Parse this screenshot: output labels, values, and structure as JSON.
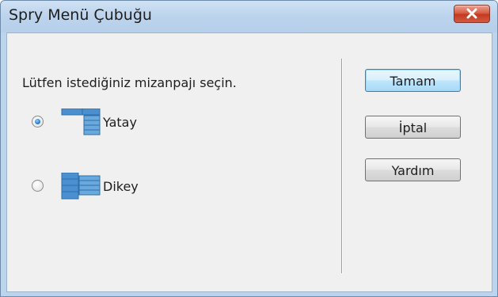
{
  "window": {
    "title": "Spry Menü Çubuğu",
    "close_icon": "close-icon"
  },
  "prompt": "Lütfen istediğiniz mizanpajı seçin.",
  "options": [
    {
      "label": "Yatay",
      "checked": true,
      "icon": "horizontal-menu-layout-icon"
    },
    {
      "label": "Dikey",
      "checked": false,
      "icon": "vertical-menu-layout-icon"
    }
  ],
  "buttons": {
    "ok": "Tamam",
    "cancel": "İptal",
    "help": "Yardım"
  },
  "colors": {
    "title_bar": "#bcd3ec",
    "close_button": "#c2391f",
    "default_button_border": "#3c7fb1",
    "radio_checked": "#1f6fc2",
    "menu_icon": "#3d86c6"
  }
}
